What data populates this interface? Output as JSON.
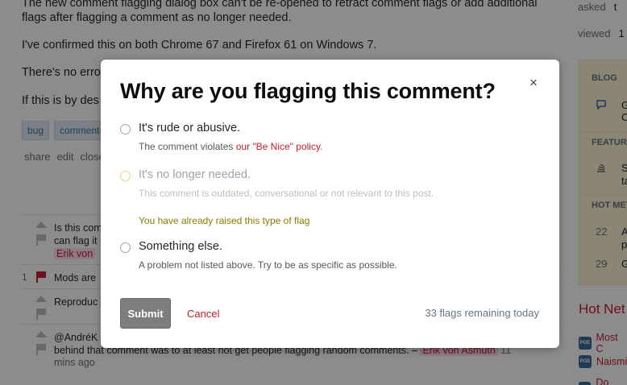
{
  "question": {
    "p1": "The new comment flagging dialog box can't be re-opened to retract comment flags or add additional flags after flagging a comment as no longer needed.",
    "p2": "I've confirmed this on both Chrome 67 and Firefox 61 on Windows 7.",
    "p3": "There's no erro",
    "p4": "If this is by des",
    "tags": [
      "bug",
      "comment-"
    ],
    "post_menu": [
      "share",
      "edit",
      "close"
    ]
  },
  "stats": {
    "asked_label": "asked",
    "asked_value": "t",
    "viewed_label": "viewed",
    "viewed_value": "1"
  },
  "comments": [
    {
      "score": "",
      "text": "Is this com",
      "text2": "can flag it",
      "user": "Erik von",
      "time": "",
      "flag_red": false
    },
    {
      "score": "1",
      "text": "Mods are",
      "text2": "",
      "user": "",
      "time": "",
      "flag_red": true
    },
    {
      "score": "",
      "text": "Reproduc",
      "text2": "",
      "user": "",
      "time": "",
      "flag_red": false
    },
    {
      "score": "",
      "text": "@AndréK",
      "text2": "behind that comment was to at least not get people flagging random comments. –",
      "user": "Erik von Asmuth",
      "time": "11",
      "time2": "mins ago",
      "flag_red": false
    }
  ],
  "sidebar": {
    "blog_header": "BLOG",
    "blog_item": "G",
    "blog_item2": "C",
    "featured_header": "FEATUR",
    "featured_item": "S",
    "featured_item2": "ta",
    "hot_meta_header": "HOT MET",
    "meta_items": [
      {
        "num": "22",
        "text": "A",
        "text2": "p"
      },
      {
        "num": "29",
        "text": "G",
        "text2": ""
      }
    ],
    "hot_network_title": "Hot Net",
    "hot_network_items": [
      "Most C",
      "Naismi",
      "Do peo"
    ],
    "site_icon_text": "POE"
  },
  "dialog": {
    "title": "Why are you flagging this comment?",
    "close_glyph": "×",
    "options": [
      {
        "label": "It's rude or abusive.",
        "desc_prefix": "The comment violates ",
        "desc_link": "our \"Be Nice\" policy",
        "desc_suffix": "."
      },
      {
        "label": "It's no longer needed.",
        "desc": "This comment is outdated, conversational or not relevant to this post.",
        "warning": "You have already raised this type of flag"
      },
      {
        "label": "Something else.",
        "desc": "A problem not listed above. Try to be as specific as possible."
      }
    ],
    "submit_label": "Submit",
    "cancel_label": "Cancel",
    "remaining_text": "33 flags remaining today"
  },
  "colors": {
    "accent_red": "#c91d2e",
    "warning_text": "#8c7b00",
    "submit_bg": "#7d7d7d",
    "overlay": "rgba(0,0,0,0.45)"
  }
}
